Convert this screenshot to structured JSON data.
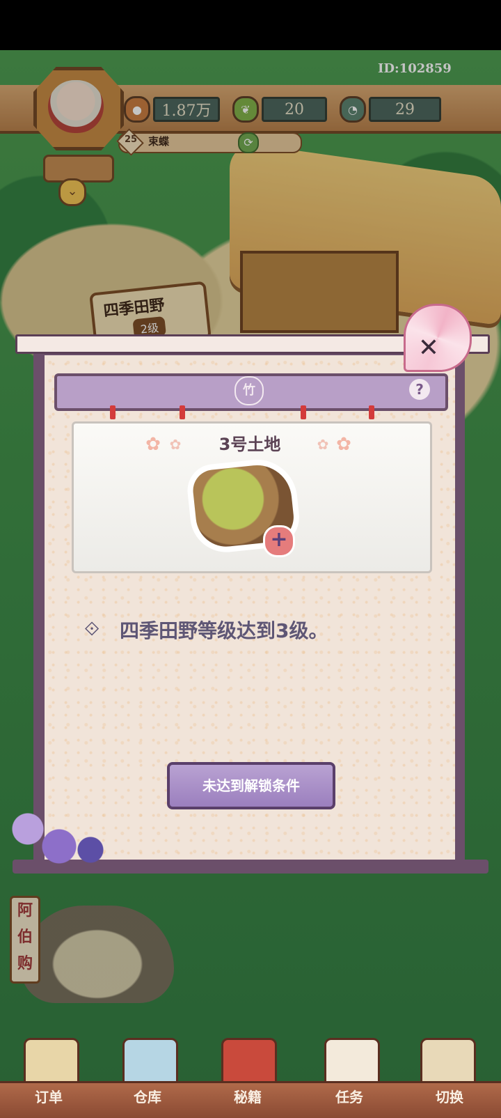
{
  "header": {
    "player_id": "ID:102859",
    "player_level": "25",
    "player_name": "束蝶",
    "resources": [
      {
        "icon": "coin-icon",
        "value": "1.87万"
      },
      {
        "icon": "leaf-icon",
        "value": "20"
      },
      {
        "icon": "stamina-icon",
        "value": "29"
      }
    ]
  },
  "scene": {
    "field_sign_name": "四季田野",
    "field_sign_level": "2级",
    "shop_sign": "阿伯购"
  },
  "dialog": {
    "card_title": "3号土地",
    "condition": "四季田野等级达到3级。",
    "unlock_button": "未达到解锁条件",
    "emblem": "竹",
    "help": "?",
    "close": "✕"
  },
  "nav": {
    "items": [
      "订单",
      "仓库",
      "秘籍",
      "任务",
      "切换"
    ]
  },
  "colors": {
    "dialog_frame": "#6b4f6a",
    "dialog_paper": "#f1e4d9",
    "button_purple": "#9b7fbe",
    "condition_text": "#5e5675"
  }
}
